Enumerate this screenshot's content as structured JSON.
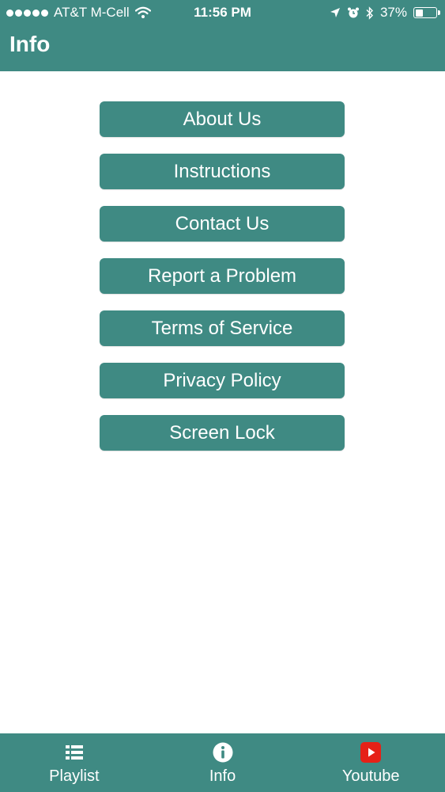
{
  "status_bar": {
    "carrier": "AT&T M-Cell",
    "time": "11:56 PM",
    "battery_percent": "37%",
    "battery_level": 0.37,
    "signal_dots": 5
  },
  "nav": {
    "title": "Info"
  },
  "menu": {
    "items": [
      {
        "label": "About Us"
      },
      {
        "label": "Instructions"
      },
      {
        "label": "Contact Us"
      },
      {
        "label": "Report a Problem"
      },
      {
        "label": "Terms of Service"
      },
      {
        "label": "Privacy Policy"
      },
      {
        "label": "Screen Lock"
      }
    ]
  },
  "tab_bar": {
    "tabs": [
      {
        "label": "Playlist",
        "icon": "list-icon"
      },
      {
        "label": "Info",
        "icon": "info-icon"
      },
      {
        "label": "Youtube",
        "icon": "youtube-icon"
      }
    ],
    "selected": "Info"
  },
  "colors": {
    "accent": "#3f8a83",
    "youtube_red": "#e62117",
    "background": "#ffffff"
  }
}
